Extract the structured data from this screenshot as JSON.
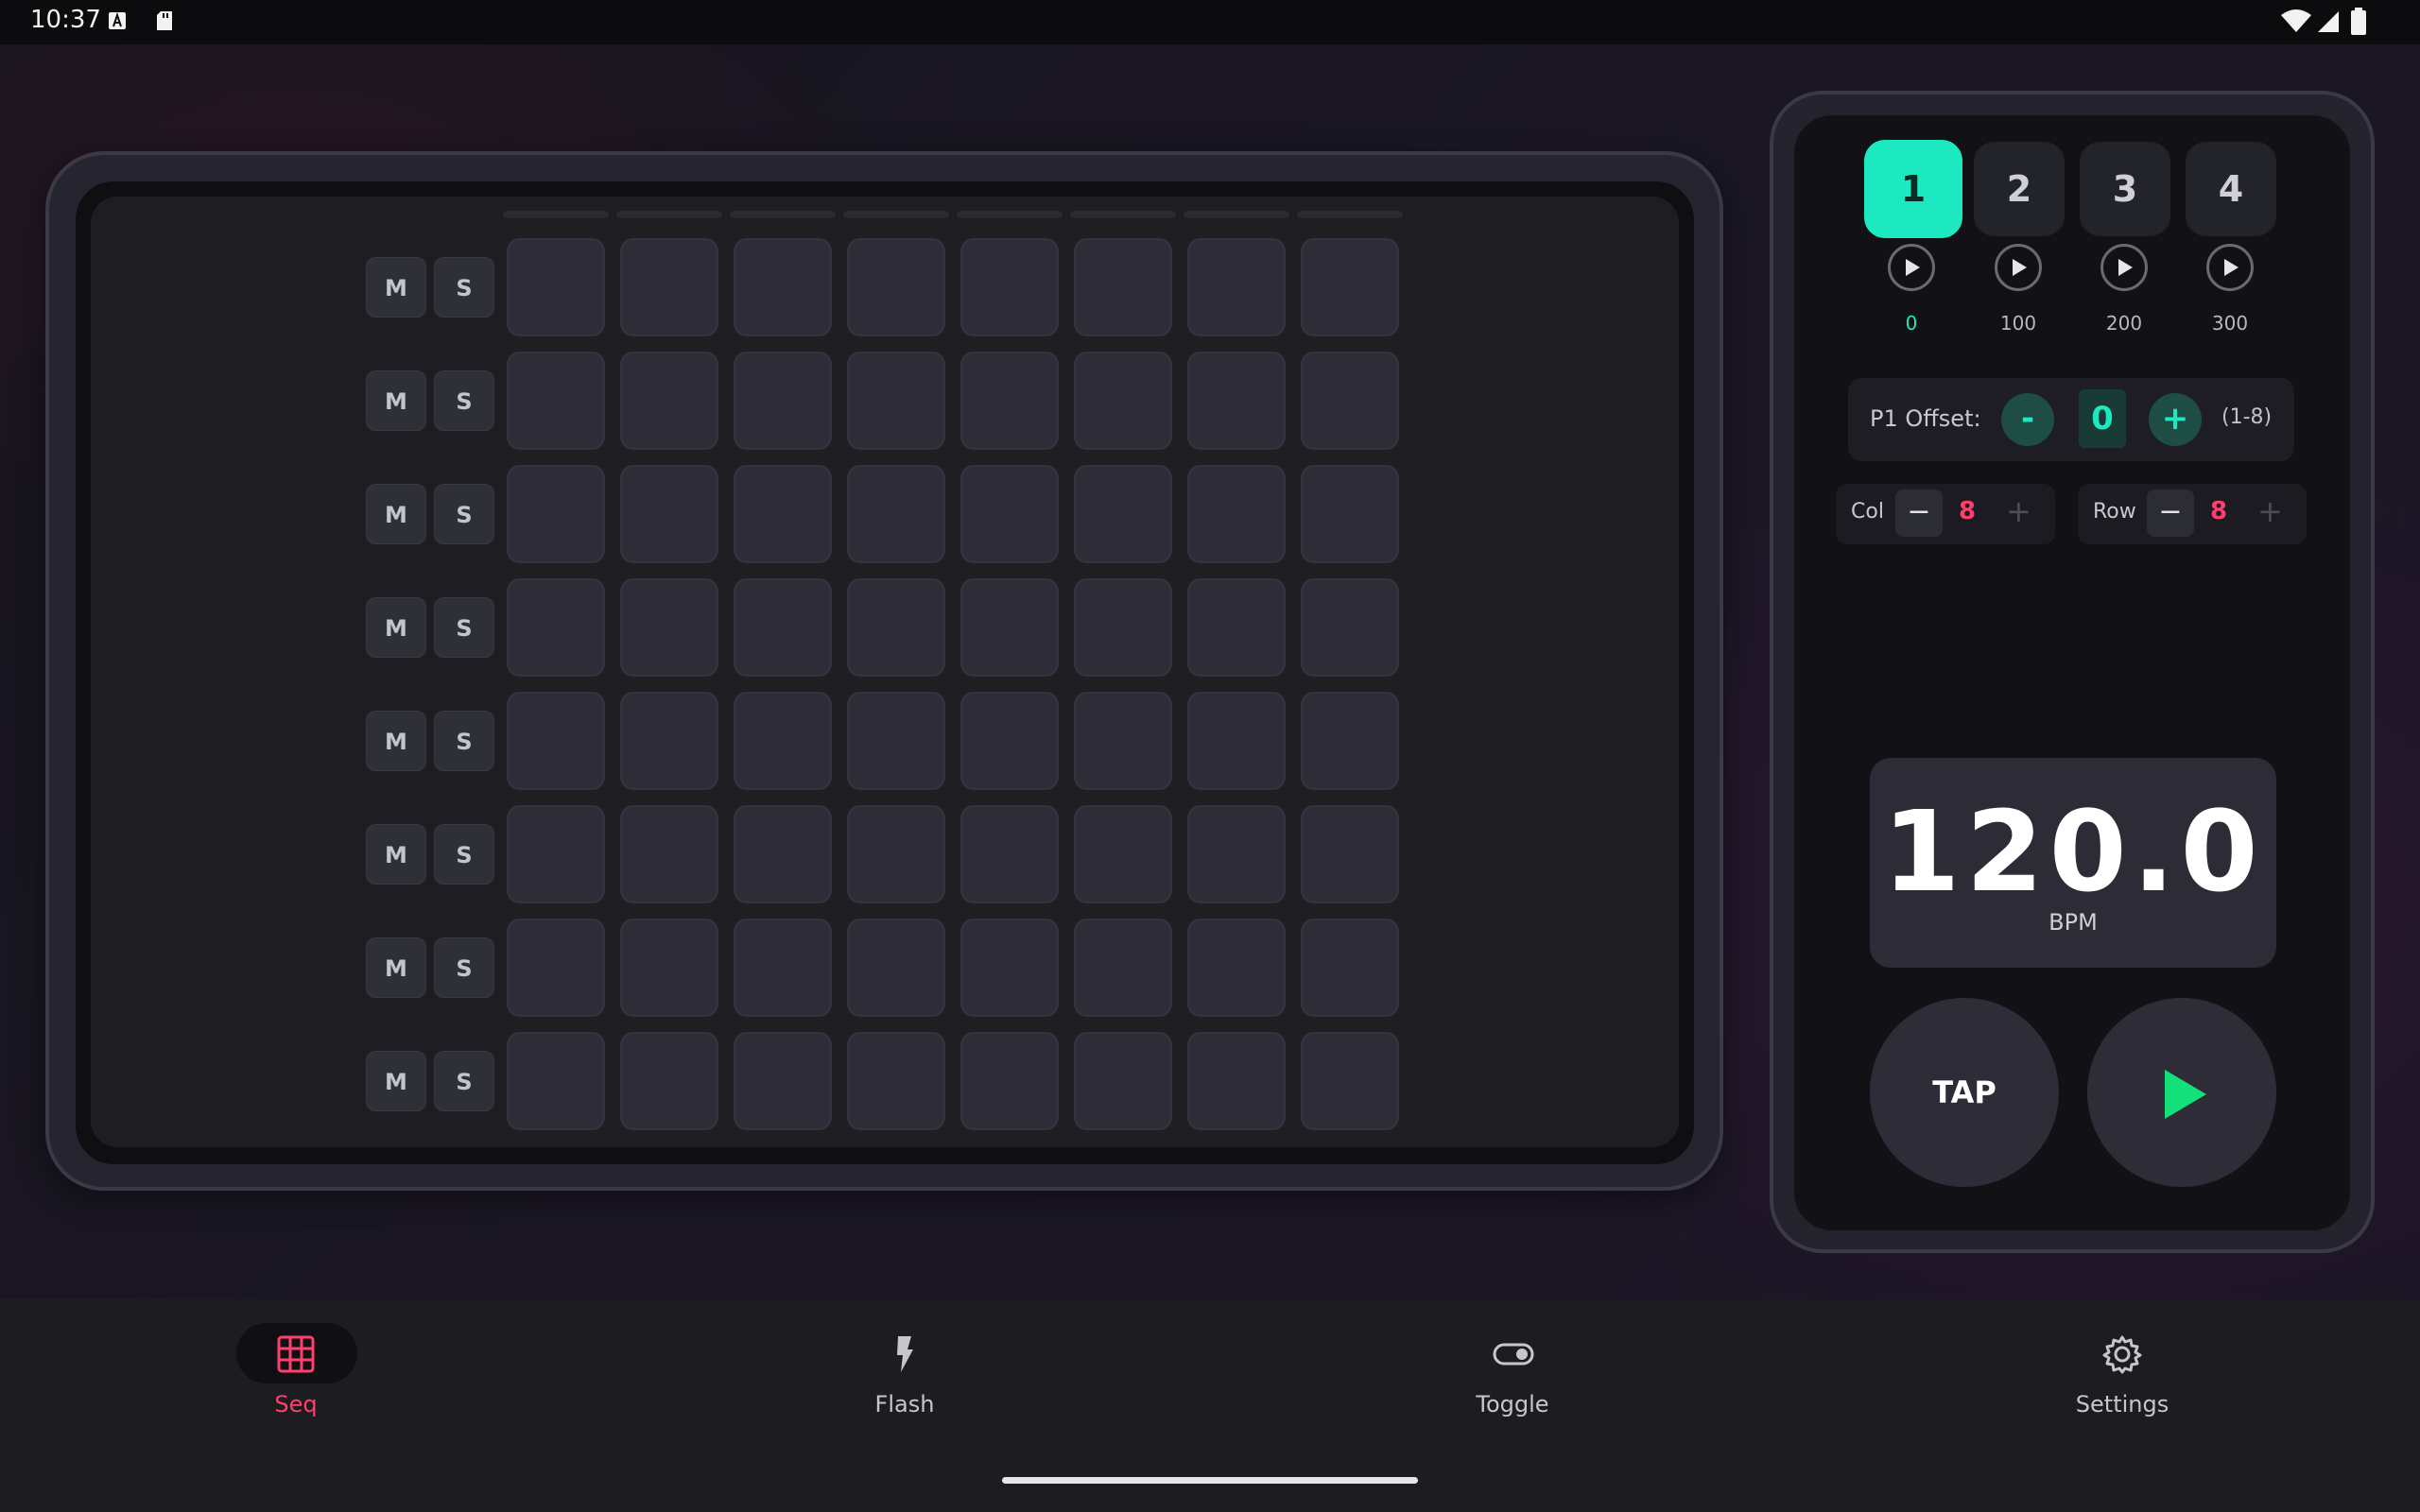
{
  "status_bar": {
    "time": "10:37",
    "left_icons": [
      "font-a-icon",
      "sd-card-icon"
    ],
    "right_icons": [
      "wifi-icon",
      "cell-signal-icon",
      "battery-icon"
    ]
  },
  "sequencer": {
    "rows": 8,
    "columns": 8,
    "mute_label": "M",
    "solo_label": "S"
  },
  "control_panel": {
    "patterns": [
      {
        "label": "1",
        "value": "0",
        "active": true
      },
      {
        "label": "2",
        "value": "100",
        "active": false
      },
      {
        "label": "3",
        "value": "200",
        "active": false
      },
      {
        "label": "4",
        "value": "300",
        "active": false
      }
    ],
    "offset": {
      "label": "P1 Offset:",
      "minus": "-",
      "value": "0",
      "plus": "+",
      "range": "(1-8)"
    },
    "col": {
      "label": "Col",
      "minus": "−",
      "value": "8",
      "plus": "+"
    },
    "row": {
      "label": "Row",
      "minus": "−",
      "value": "8",
      "plus": "+"
    },
    "bpm": {
      "value": "120.0",
      "label": "BPM"
    },
    "tap_label": "TAP",
    "accent_color": "#1de9c0",
    "play_color": "#14e07a",
    "highlight_color": "#ff3f6c"
  },
  "nav": {
    "items": [
      {
        "label": "Seq",
        "icon": "grid-icon",
        "active": true
      },
      {
        "label": "Flash",
        "icon": "flash-icon",
        "active": false
      },
      {
        "label": "Toggle",
        "icon": "toggle-icon",
        "active": false
      },
      {
        "label": "Settings",
        "icon": "gear-icon",
        "active": false
      }
    ]
  }
}
